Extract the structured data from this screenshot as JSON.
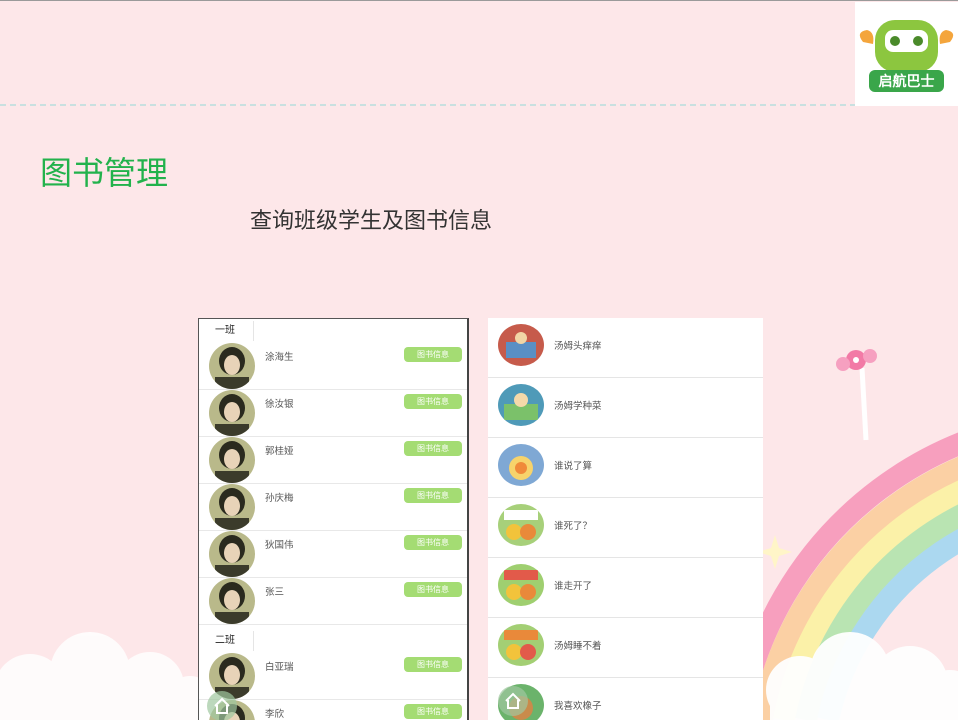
{
  "header": {
    "logo_text": "启航巴士"
  },
  "page": {
    "title": "图书管理",
    "subtitle": "查询班级学生及图书信息"
  },
  "students": {
    "button_label": "图书信息",
    "groups": [
      {
        "class_name": "一班",
        "members": [
          "涂海生",
          "徐汝银",
          "郭桂娅",
          "孙庆梅",
          "狄国伟",
          "张三"
        ]
      },
      {
        "class_name": "二班",
        "members": [
          "白亚瑞",
          "李欣"
        ]
      }
    ]
  },
  "books": [
    {
      "title": "汤姆头痒痒",
      "color": "#c65b4b"
    },
    {
      "title": "汤姆学种菜",
      "color": "#4f9ab8"
    },
    {
      "title": "谁说了算",
      "color": "#7fa8d4"
    },
    {
      "title": "谁死了？",
      "color": "#e0a43c"
    },
    {
      "title": "谁走开了",
      "color": "#e9a23b"
    },
    {
      "title": "汤姆睡不着",
      "color": "#d88d3a"
    },
    {
      "title": "我喜欢橡子",
      "color": "#6bb36b"
    }
  ],
  "colors": {
    "title": "#22b24c",
    "button": "#a4dc73",
    "background": "#fde7e9"
  }
}
